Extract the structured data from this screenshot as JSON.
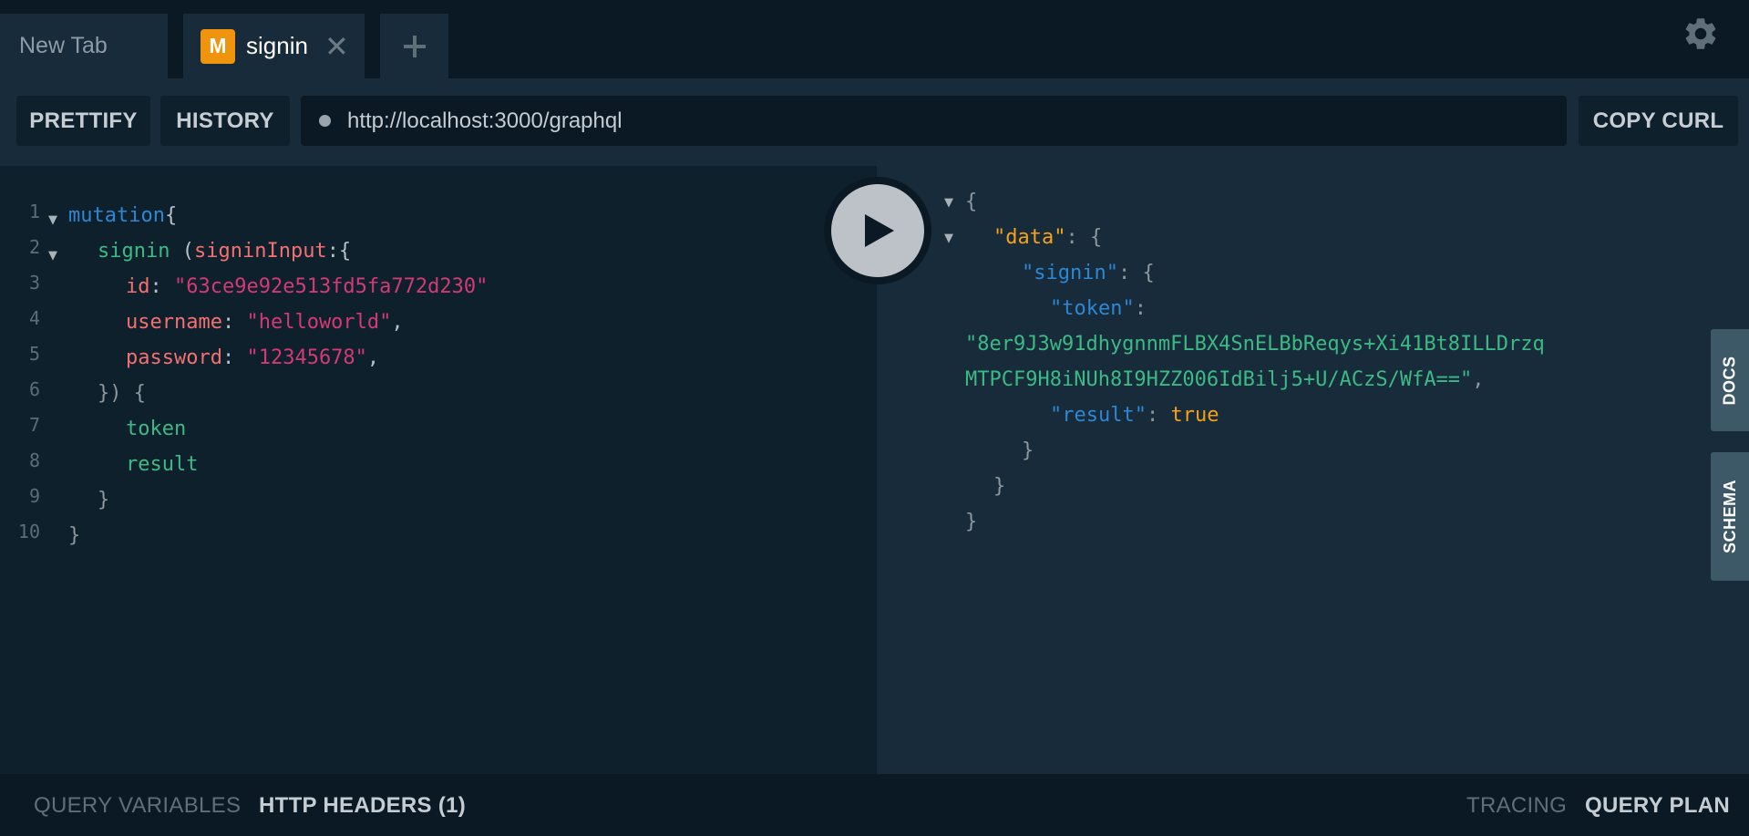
{
  "tabs": [
    {
      "label": "New Tab"
    },
    {
      "badge": "M",
      "label": "signin",
      "close": "✕"
    }
  ],
  "add_tab_icon": "plus-icon",
  "settings_icon": "gear-icon",
  "toolbar": {
    "prettify": "PRETTIFY",
    "history": "HISTORY",
    "endpoint": "http://localhost:3000/graphql",
    "copy_curl": "COPY CURL"
  },
  "editor": {
    "line_numbers": [
      "1",
      "2",
      "3",
      "4",
      "5",
      "6",
      "7",
      "8",
      "9",
      "10"
    ],
    "lines": {
      "l1": {
        "keyword": "mutation",
        "brace": "{"
      },
      "l2": {
        "field": "signin",
        "paren": " (",
        "arg": "signinInput",
        "colon": ":{"
      },
      "l3": {
        "key": "id",
        "colon": ": ",
        "value": "\"63ce9e92e513fd5fa772d230\""
      },
      "l4": {
        "key": "username",
        "colon": ": ",
        "value": "\"helloworld\"",
        "comma": ","
      },
      "l5": {
        "key": "password",
        "colon": ": ",
        "value": "\"12345678\"",
        "comma": ","
      },
      "l6": {
        "text": "}) {"
      },
      "l7": {
        "field": "token"
      },
      "l8": {
        "field": "result"
      },
      "l9": {
        "text": "}"
      },
      "l10": {
        "text": "}"
      }
    }
  },
  "response": {
    "open": "{",
    "data_key": "\"data\"",
    "data_colon": ": {",
    "signin_key": "\"signin\"",
    "signin_colon": ": {",
    "token_key": "\"token\"",
    "token_colon": ":",
    "token_value_1": "\"8er9J3w91dhygnnmFLBX4SnELBbReqys+Xi41Bt8ILLDrzq",
    "token_value_2": "MTPCF9H8iNUh8I9HZZ006IdBilj5+U/ACzS/WfA==\"",
    "token_comma": ",",
    "result_key": "\"result\"",
    "result_colon": ": ",
    "result_value": "true",
    "close1": "}",
    "close2": "}",
    "close3": "}"
  },
  "side_tabs": {
    "docs": "DOCS",
    "schema": "SCHEMA"
  },
  "bottom": {
    "query_variables": "QUERY VARIABLES",
    "http_headers": "HTTP HEADERS (1)",
    "tracing": "TRACING",
    "query_plan": "QUERY PLAN"
  }
}
